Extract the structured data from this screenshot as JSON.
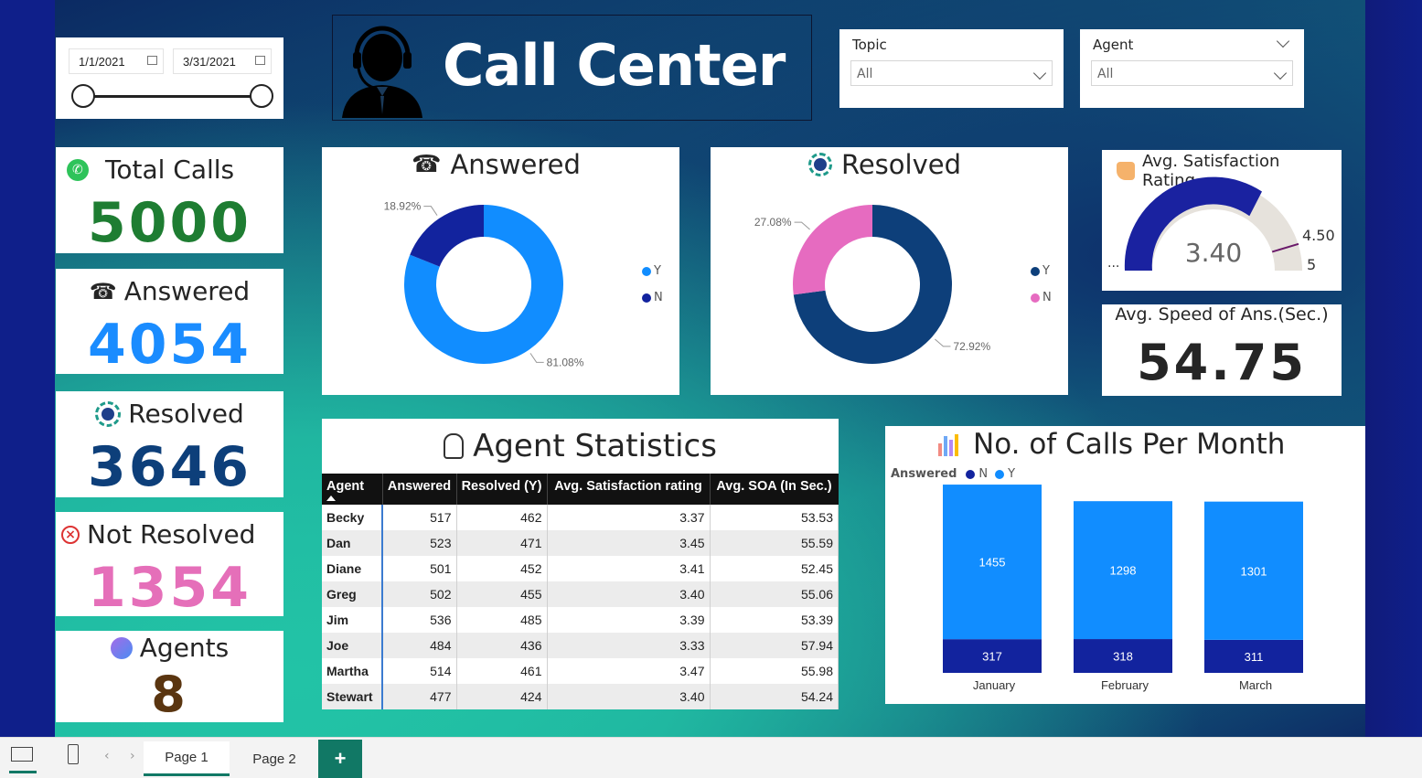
{
  "header": {
    "title": "Call Center"
  },
  "date_range": {
    "start": "1/1/2021",
    "end": "3/31/2021"
  },
  "slicers": [
    {
      "label": "Topic",
      "value": "All"
    },
    {
      "label": "Agent",
      "value": "All"
    }
  ],
  "kpis": {
    "total_calls": {
      "label": "Total Calls",
      "value": "5000",
      "color": "#1e7d32"
    },
    "answered": {
      "label": "Answered",
      "value": "4054",
      "color": "#1a8cff"
    },
    "resolved": {
      "label": "Resolved",
      "value": "3646",
      "color": "#0d3f7a"
    },
    "not_resolved": {
      "label": "Not Resolved",
      "value": "1354",
      "color": "#e56fb9"
    },
    "agents": {
      "label": "Agents",
      "value": "8",
      "color": "#5a3510"
    }
  },
  "answered_chart": {
    "title": "Answered",
    "label_y": "81.08%",
    "label_n": "18.92%",
    "legend_y": "Y",
    "legend_n": "N",
    "color_y": "#118dff",
    "color_n": "#12239e"
  },
  "resolved_chart": {
    "title": "Resolved",
    "label_y": "72.92%",
    "label_n": "27.08%",
    "legend_y": "Y",
    "legend_n": "N",
    "color_y": "#0d3f7a",
    "color_n": "#e66bc0"
  },
  "satisfaction": {
    "title": "Avg. Satisfaction Rating",
    "value": "3.40",
    "target": "4.50",
    "max": "5",
    "min": "..."
  },
  "speed": {
    "title": "Avg. Speed of Ans.(Sec.)",
    "value": "54.75"
  },
  "agent_stats": {
    "title": "Agent Statistics",
    "columns": [
      "Agent",
      "Answered",
      "Resolved (Y)",
      "Avg. Satisfaction rating",
      "Avg. SOA (In Sec.)"
    ],
    "rows": [
      [
        "Becky",
        "517",
        "462",
        "3.37",
        "53.53"
      ],
      [
        "Dan",
        "523",
        "471",
        "3.45",
        "55.59"
      ],
      [
        "Diane",
        "501",
        "452",
        "3.41",
        "52.45"
      ],
      [
        "Greg",
        "502",
        "455",
        "3.40",
        "55.06"
      ],
      [
        "Jim",
        "536",
        "485",
        "3.39",
        "53.39"
      ],
      [
        "Joe",
        "484",
        "436",
        "3.33",
        "57.94"
      ],
      [
        "Martha",
        "514",
        "461",
        "3.47",
        "55.98"
      ],
      [
        "Stewart",
        "477",
        "424",
        "3.40",
        "54.24"
      ]
    ]
  },
  "monthly": {
    "title": "No. of Calls Per Month",
    "legend_title": "Answered",
    "legend_n": "N",
    "legend_y": "Y"
  },
  "chart_data": [
    {
      "type": "pie",
      "title": "Answered",
      "categories": [
        "Y",
        "N"
      ],
      "values": [
        81.08,
        18.92
      ]
    },
    {
      "type": "pie",
      "title": "Resolved",
      "categories": [
        "Y",
        "N"
      ],
      "values": [
        72.92,
        27.08
      ]
    },
    {
      "type": "bar",
      "title": "No. of Calls Per Month",
      "stacked": true,
      "categories": [
        "January",
        "February",
        "March"
      ],
      "series": [
        {
          "name": "N",
          "values": [
            317,
            318,
            311
          ],
          "color": "#12239e"
        },
        {
          "name": "Y",
          "values": [
            1455,
            1298,
            1301
          ],
          "color": "#118dff"
        }
      ],
      "ylim": [
        0,
        1850
      ]
    }
  ],
  "tabs": {
    "page1": "Page 1",
    "page2": "Page 2",
    "add": "+"
  }
}
